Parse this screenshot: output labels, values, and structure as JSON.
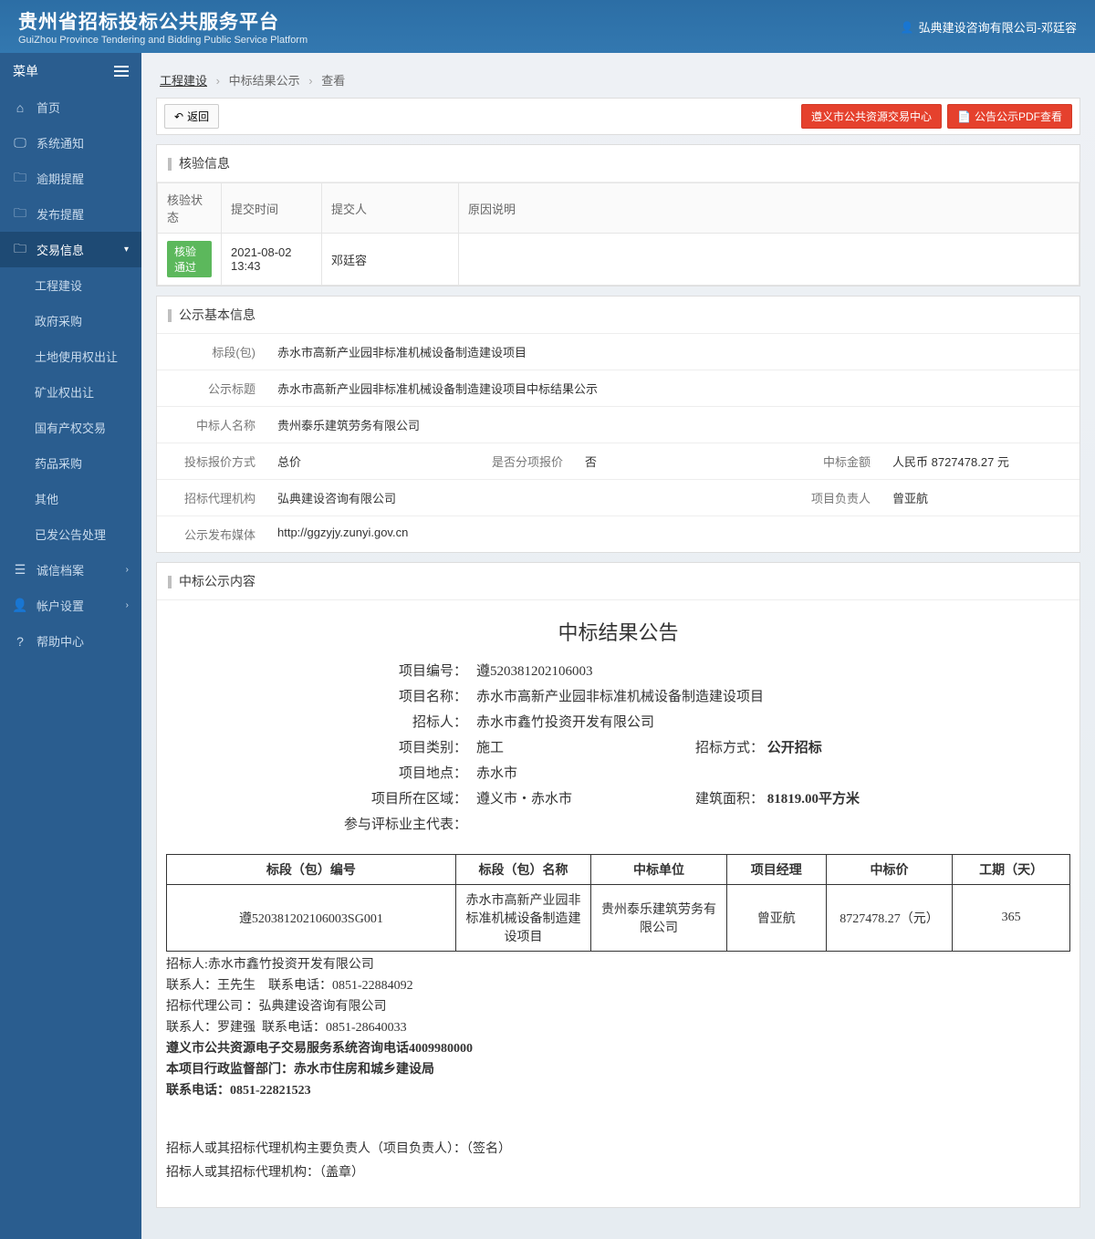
{
  "header": {
    "title": "贵州省招标投标公共服务平台",
    "subtitle": "GuiZhou Province Tendering and Bidding Public Service Platform",
    "user": "弘典建设咨询有限公司-邓廷容"
  },
  "sidebar": {
    "menu_label": "菜单",
    "items": {
      "home": "首页",
      "sys_notice": "系统通知",
      "overdue": "逾期提醒",
      "publish": "发布提醒",
      "trade_info": "交易信息",
      "integrity": "诚信档案",
      "account": "帐户设置",
      "help": "帮助中心"
    },
    "sub": {
      "engineering": "工程建设",
      "gov_procure": "政府采购",
      "land": "土地使用权出让",
      "mineral": "矿业权出让",
      "state_asset": "国有产权交易",
      "drug": "药品采购",
      "other": "其他",
      "sent": "已发公告处理"
    }
  },
  "breadcrumb": {
    "a": "工程建设",
    "b": "中标结果公示",
    "c": "查看"
  },
  "toolbar": {
    "back": "返回",
    "right1": "遵义市公共资源交易中心",
    "right2": "公告公示PDF查看"
  },
  "panel1": {
    "title": "核验信息",
    "cols": {
      "status": "核验状态",
      "time": "提交时间",
      "person": "提交人",
      "reason": "原因说明"
    },
    "row": {
      "status": "核验通过",
      "time": "2021-08-02 13:43",
      "person": "邓廷容",
      "reason": ""
    }
  },
  "panel2": {
    "title": "公示基本信息",
    "labels": {
      "section": "标段(包)",
      "pub_title": "公示标题",
      "winner": "中标人名称",
      "quote_type": "投标报价方式",
      "partial": "是否分项报价",
      "amount": "中标金额",
      "agent": "招标代理机构",
      "manager": "项目负责人",
      "media": "公示发布媒体"
    },
    "vals": {
      "section": "赤水市高新产业园非标准机械设备制造建设项目",
      "pub_title": "赤水市高新产业园非标准机械设备制造建设项目中标结果公示",
      "winner": "贵州泰乐建筑劳务有限公司",
      "quote_type": "总价",
      "partial": "否",
      "amount": "人民币 8727478.27 元",
      "agent": "弘典建设咨询有限公司",
      "manager": "曾亚航",
      "media": "http://ggzyjy.zunyi.gov.cn"
    }
  },
  "panel3": {
    "title": "中标公示内容",
    "doc_title": "中标结果公告",
    "rows": {
      "proj_no_l": "项目编号：",
      "proj_no_v": "遵520381202106003",
      "proj_name_l": "项目名称：",
      "proj_name_v": "赤水市高新产业园非标准机械设备制造建设项目",
      "tenderee_l": "招标人：",
      "tenderee_v": "赤水市鑫竹投资开发有限公司",
      "category_l": "项目类别：",
      "category_v": "施工",
      "bid_method_l": "招标方式：",
      "bid_method_v": "公开招标",
      "addr_l": "项目地点：",
      "addr_v": "赤水市",
      "region_l": "项目所在区域：",
      "region_v": "遵义市・赤水市",
      "area_l": "建筑面积：",
      "area_v": "81819.00平方米",
      "rep_l": "参与评标业主代表："
    },
    "table": {
      "h1": "标段（包）编号",
      "h2": "标段（包）名称",
      "h3": "中标单位",
      "h4": "项目经理",
      "h5": "中标价",
      "h6": "工期（天）",
      "c1": "遵520381202106003SG001",
      "c2": "赤水市高新产业园非标准机械设备制造建设项目",
      "c3": "贵州泰乐建筑劳务有限公司",
      "c4": "曾亚航",
      "c5": "8727478.27（元）",
      "c6": "365"
    },
    "footer": {
      "l1": "招标人:赤水市鑫竹投资开发有限公司",
      "l2a": "联系人：王先生",
      "l2b": "联系电话：0851-22884092",
      "l3": "招标代理公司 ：弘典建设咨询有限公司",
      "l4a": "联系人：罗建强",
      "l4b": "联系电话：0851-28640033",
      "l5": "遵义市公共资源电子交易服务系统咨询电话4009980000",
      "l6": "本项目行政监督部门：赤水市住房和城乡建设局",
      "l7": "联系电话：0851-22821523",
      "s1": "招标人或其招标代理机构主要负责人（项目负责人）：（签名）",
      "s2": "招标人或其招标代理机构：（盖章）"
    }
  }
}
